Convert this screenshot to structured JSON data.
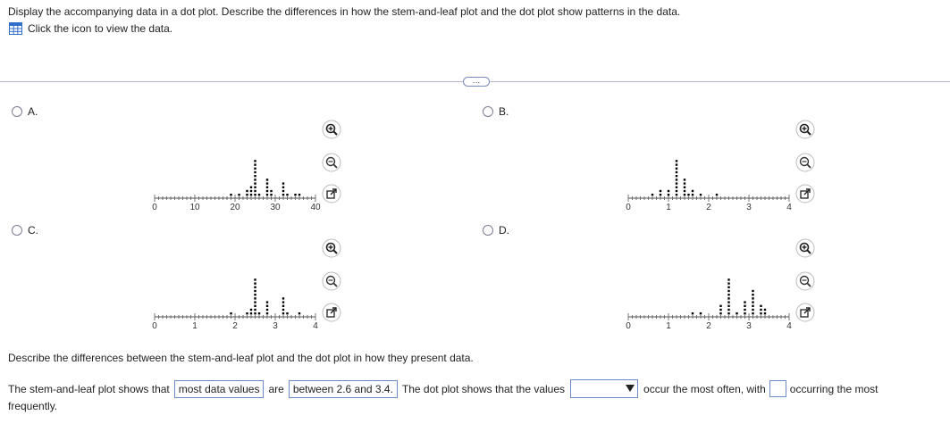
{
  "question": "Display the accompanying data in a dot plot. Describe the differences in how the stem-and-leaf plot and the dot plot show patterns in the data.",
  "data_link": "Click the icon to view the data.",
  "more_button": "…",
  "options": [
    {
      "letter": "A.",
      "ticks": [
        "0",
        "10",
        "20",
        "30",
        "40"
      ],
      "axis_max": 40,
      "counts": [
        [
          19,
          1
        ],
        [
          21,
          1
        ],
        [
          23,
          2
        ],
        [
          24,
          3
        ],
        [
          25,
          10
        ],
        [
          26,
          1
        ],
        [
          28,
          5
        ],
        [
          29,
          2
        ],
        [
          32,
          4
        ],
        [
          33,
          1
        ],
        [
          35,
          1
        ],
        [
          36,
          1
        ]
      ]
    },
    {
      "letter": "B.",
      "ticks": [
        "0",
        "1",
        "2",
        "3",
        "4"
      ],
      "axis_max": 4,
      "counts": [
        [
          0.6,
          1
        ],
        [
          0.8,
          2
        ],
        [
          1.0,
          2
        ],
        [
          1.2,
          10
        ],
        [
          1.4,
          5
        ],
        [
          1.5,
          1
        ],
        [
          1.6,
          2
        ],
        [
          1.8,
          1
        ],
        [
          2.2,
          1
        ]
      ]
    },
    {
      "letter": "C.",
      "ticks": [
        "0",
        "1",
        "2",
        "3",
        "4"
      ],
      "axis_max": 4,
      "counts": [
        [
          1.9,
          1
        ],
        [
          2.3,
          1
        ],
        [
          2.4,
          2
        ],
        [
          2.5,
          10
        ],
        [
          2.6,
          1
        ],
        [
          2.8,
          4
        ],
        [
          3.2,
          5
        ],
        [
          3.3,
          1
        ],
        [
          3.6,
          1
        ]
      ]
    },
    {
      "letter": "D.",
      "ticks": [
        "0",
        "1",
        "2",
        "3",
        "4"
      ],
      "axis_max": 4,
      "counts": [
        [
          1.6,
          1
        ],
        [
          1.8,
          1
        ],
        [
          2.3,
          3
        ],
        [
          2.5,
          10
        ],
        [
          2.7,
          1
        ],
        [
          2.9,
          4
        ],
        [
          3.1,
          7
        ],
        [
          3.3,
          3
        ],
        [
          3.4,
          2
        ]
      ]
    }
  ],
  "describe_prompt": "Describe the differences between the stem-and-leaf plot and the dot plot in how they present data.",
  "answer": {
    "part1": "The stem-and-leaf plot shows that",
    "box1": "most data values",
    "part2": "are",
    "box2": "between 2.6 and 3.4.",
    "part3": "The dot plot shows that the values",
    "dropdown": "",
    "part4": "occur the most often, with",
    "blank": "",
    "part5": "occurring the most",
    "part6": "frequently."
  },
  "colors": {
    "accent": "#6b8bc6",
    "divider": "#b8b8c8",
    "dot": "#000000"
  }
}
